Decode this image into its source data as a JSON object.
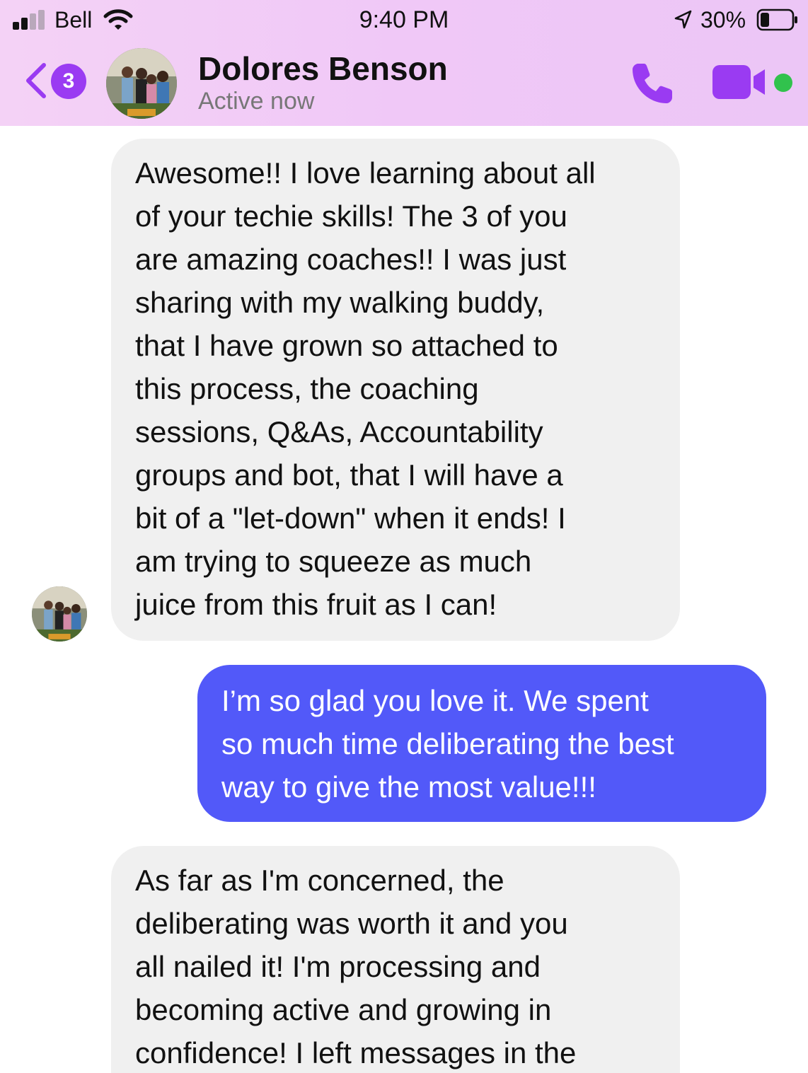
{
  "status_bar": {
    "carrier": "Bell",
    "time": "9:40 PM",
    "battery_percent": "30%",
    "signal_bars_filled": 2,
    "battery_level": 0.3,
    "icons": [
      "signal-icon",
      "wifi-icon",
      "location-arrow-icon",
      "battery-icon"
    ]
  },
  "header": {
    "back_badge_count": "3",
    "contact_name": "Dolores Benson",
    "contact_status": "Active now",
    "icons": [
      "back-chevron-icon",
      "phone-icon",
      "video-camera-icon"
    ],
    "accent_color": "#9a3bf2",
    "active_color": "#31c24d"
  },
  "messages": [
    {
      "direction": "incoming",
      "text": "Awesome!! I love learning about all\nof your techie skills! The 3 of you\nare amazing coaches!! I was just\nsharing with my walking buddy,\nthat I have grown so attached to\nthis process, the coaching\nsessions, Q&As, Accountability\ngroups and bot, that I will have a\nbit of a \"let-down\" when it ends! I\nam trying to squeeze as much\njuice from this fruit as I can!"
    },
    {
      "direction": "outgoing",
      "text": "I’m so glad you love it.  We spent\nso much time deliberating the best\nway to give the most value!!!"
    },
    {
      "direction": "incoming",
      "text": "As far as I'm concerned, the\ndeliberating was worth it and you\nall nailed it! I'm processing and\nbecoming active and growing in\nconfidence! I left messages in the"
    }
  ],
  "colors": {
    "incoming_bubble": "#f0f0f0",
    "outgoing_bubble": "#5259f9",
    "header_background": "#f0c8f7"
  }
}
